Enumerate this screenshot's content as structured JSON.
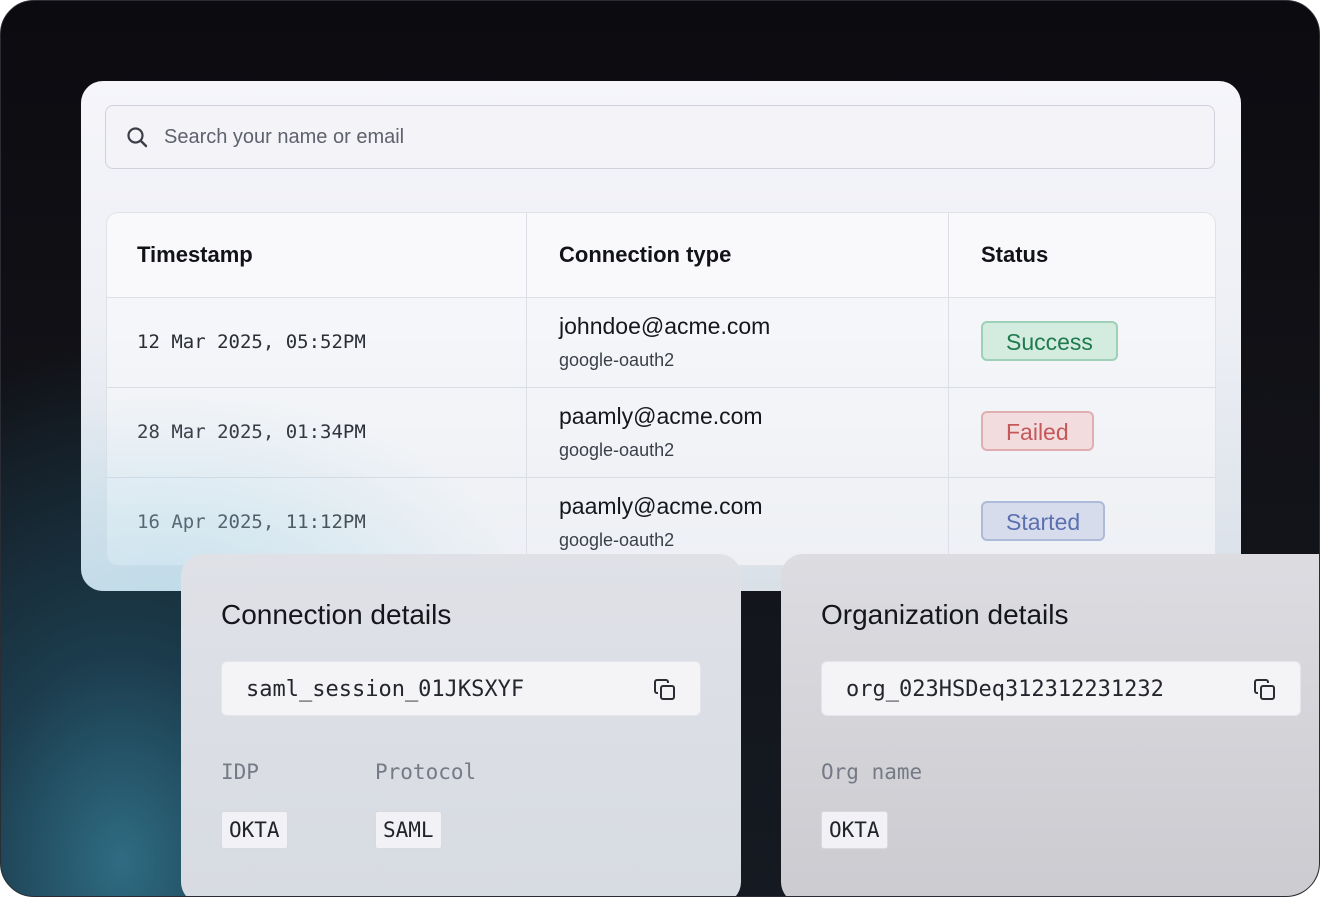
{
  "search": {
    "placeholder": "Search your name or email"
  },
  "table": {
    "columns": [
      "Timestamp",
      "Connection type",
      "Status"
    ],
    "rows": [
      {
        "timestamp": "12 Mar 2025, 05:52PM",
        "email": "johndoe@acme.com",
        "connection": "google-oauth2",
        "status": "Success"
      },
      {
        "timestamp": "28 Mar 2025, 01:34PM",
        "email": "paamly@acme.com",
        "connection": "google-oauth2",
        "status": "Failed"
      },
      {
        "timestamp": "16 Apr 2025, 11:12PM",
        "email": "paamly@acme.com",
        "connection": "google-oauth2",
        "status": "Started"
      }
    ]
  },
  "connection_details": {
    "title": "Connection details",
    "session_id": "saml_session_01JKSXYF",
    "copy_icon": "copy-icon",
    "fields": [
      {
        "label": "IDP",
        "value": "OKTA"
      },
      {
        "label": "Protocol",
        "value": "SAML"
      }
    ]
  },
  "organization_details": {
    "title": "Organization details",
    "org_id": "org_023HSDeq312312231232",
    "copy_icon": "copy-icon",
    "fields": [
      {
        "label": "Org name",
        "value": "OKTA"
      }
    ]
  },
  "colors": {
    "success": "#1f7a4e",
    "failed": "#c4585b",
    "started": "#5b70b0",
    "background": "#0c0b10"
  }
}
